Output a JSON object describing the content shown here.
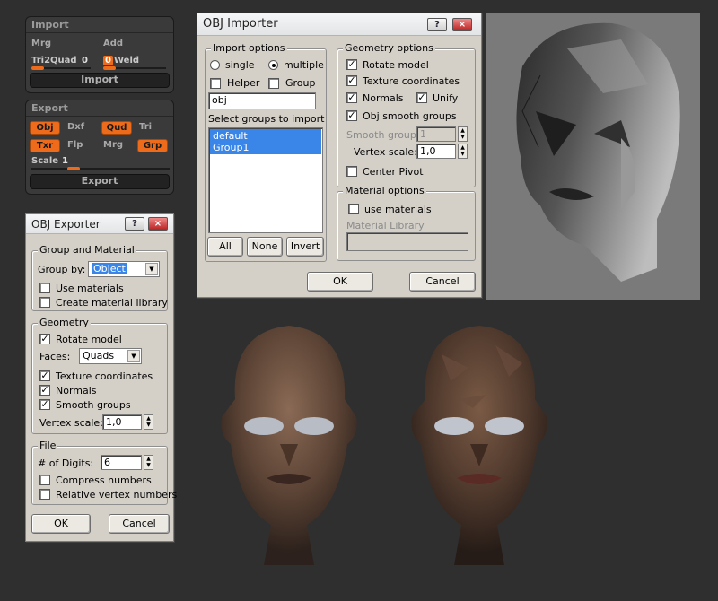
{
  "import_palette": {
    "title": "Import",
    "mrg": "Mrg",
    "add": "Add",
    "tri2quad_label": "Tri2Quad",
    "tri2quad_value": "0",
    "weld_value": "0",
    "weld_label": "Weld",
    "import_button": "Import"
  },
  "export_palette": {
    "title": "Export",
    "obj": "Obj",
    "dxf": "Dxf",
    "qud": "Qud",
    "tri": "Tri",
    "txr": "Txr",
    "flp": "Flp",
    "mrg": "Mrg",
    "grp": "Grp",
    "scale_label": "Scale",
    "scale_value": "1",
    "export_button": "Export"
  },
  "obj_exporter": {
    "title": "OBJ Exporter",
    "help": "?",
    "close": "×",
    "group_material": "Group and Material",
    "group_by_label": "Group by:",
    "group_by_value": "Object",
    "use_materials": "Use materials",
    "create_material_library": "Create material library",
    "geometry": "Geometry",
    "rotate_model": "Rotate model",
    "faces_label": "Faces:",
    "faces_value": "Quads",
    "texture_coordinates": "Texture coordinates",
    "normals": "Normals",
    "smooth_groups": "Smooth groups",
    "vertex_scale_label": "Vertex scale:",
    "vertex_scale_value": "1,0",
    "file": "File",
    "digits_label": "# of Digits:",
    "digits_value": "6",
    "compress_numbers": "Compress numbers",
    "relative_vertex_numbers": "Relative vertex numbers",
    "ok": "OK",
    "cancel": "Cancel"
  },
  "obj_importer": {
    "title": "OBJ Importer",
    "help": "?",
    "close": "×",
    "import_options": "Import options",
    "single": "single",
    "multiple": "multiple",
    "helper": "Helper",
    "group": "Group",
    "name_value": "obj",
    "select_groups": "Select groups to import",
    "groups": [
      "default",
      "Group1"
    ],
    "all": "All",
    "none": "None",
    "invert": "Invert",
    "geometry_options": "Geometry options",
    "rotate_model": "Rotate model",
    "texture_coordinates": "Texture coordinates",
    "normals": "Normals",
    "unify": "Unify",
    "obj_smooth_groups": "Obj smooth groups",
    "smooth_group_label": "Smooth group:",
    "smooth_group_value": "1",
    "vertex_scale_label": "Vertex scale:",
    "vertex_scale_value": "1,0",
    "center_pivot": "Center Pivot",
    "material_options": "Material options",
    "use_materials": "use materials",
    "material_library": "Material Library",
    "ok": "OK",
    "cancel": "Cancel"
  },
  "colors": {
    "accent_orange": "#ee6b1c",
    "selection_blue": "#3a86e8",
    "background": "#2f2f2f"
  }
}
